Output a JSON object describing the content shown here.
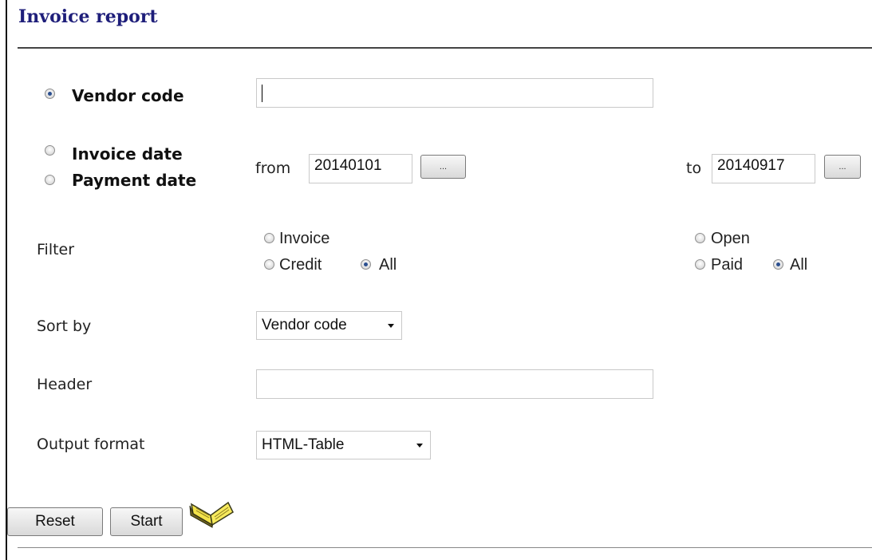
{
  "page": {
    "title": "Invoice report"
  },
  "selection": {
    "vendor_code_label": "Vendor code",
    "vendor_code_value": "",
    "invoice_date_label": "Invoice date",
    "payment_date_label": "Payment date"
  },
  "date_range": {
    "from_label": "from",
    "from_value": "20140101",
    "to_label": "to",
    "to_value": "20140917",
    "picker_button_label": "..."
  },
  "filter": {
    "label": "Filter",
    "type_options": [
      "Invoice",
      "Credit",
      "All"
    ],
    "type_selected": "All",
    "status_options": [
      "Open",
      "Paid",
      "All"
    ],
    "status_selected": "All"
  },
  "sort_by": {
    "label": "Sort by",
    "value": "Vendor code"
  },
  "header": {
    "label": "Header",
    "value": ""
  },
  "output_format": {
    "label": "Output format",
    "value": "HTML-Table"
  },
  "actions": {
    "reset_label": "Reset",
    "start_label": "Start"
  },
  "icons": {
    "help": "open-book-icon"
  },
  "colors": {
    "title": "#1e1e7a",
    "radio_dot": "#2b4f8f"
  }
}
